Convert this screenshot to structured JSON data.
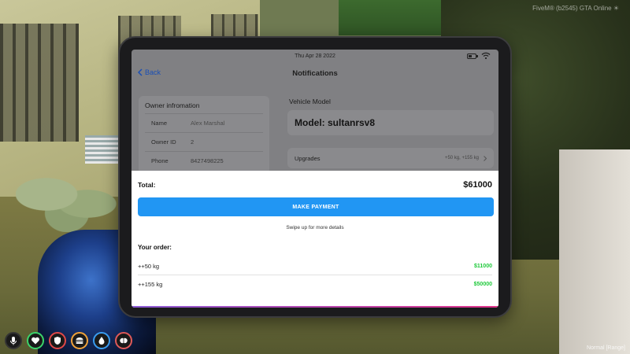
{
  "overlay": {
    "watermark": "FiveM® (b2545) GTA Online ☀",
    "voice_status": "Normal [Range]"
  },
  "hud": {
    "icons": [
      "microphone-icon",
      "heart-icon",
      "shield-icon",
      "burger-icon",
      "water-drop-icon",
      "brain-icon"
    ],
    "colors": {
      "mic": "#ffffff",
      "health": "#3bd46b",
      "armor": "#e04848",
      "hunger": "#f0a23a",
      "thirst": "#3a9cf0",
      "stress": "#e05a5a"
    }
  },
  "tablet": {
    "status_bar": {
      "date": "Thu Apr 28 2022"
    },
    "nav": {
      "back_label": "Back",
      "title": "Notifications"
    },
    "owner": {
      "title": "Owner infromation",
      "rows": [
        {
          "key": "Name",
          "value": "Alex Marshal"
        },
        {
          "key": "Owner ID",
          "value": "2"
        },
        {
          "key": "Phone",
          "value": "8427498225"
        }
      ]
    },
    "vehicle": {
      "section_label": "Vehicle Model",
      "model_value": "Model: sultanrsv8",
      "upgrades_label": "Upgrades",
      "upgrades_summary": "+50 kg, +155 kg"
    },
    "sheet": {
      "total_label": "Total:",
      "total_value": "$61000",
      "pay_button_label": "MAKE PAYMENT",
      "swipe_hint": "Swipe up for more details",
      "order_title": "Your order:",
      "order_items": [
        {
          "name": "++50 kg",
          "price": "$11000"
        },
        {
          "name": "++155 kg",
          "price": "$50000"
        }
      ]
    },
    "colors": {
      "accent": "#2196f3",
      "price": "#1ec93a",
      "back_link": "#1a4fb5"
    }
  }
}
